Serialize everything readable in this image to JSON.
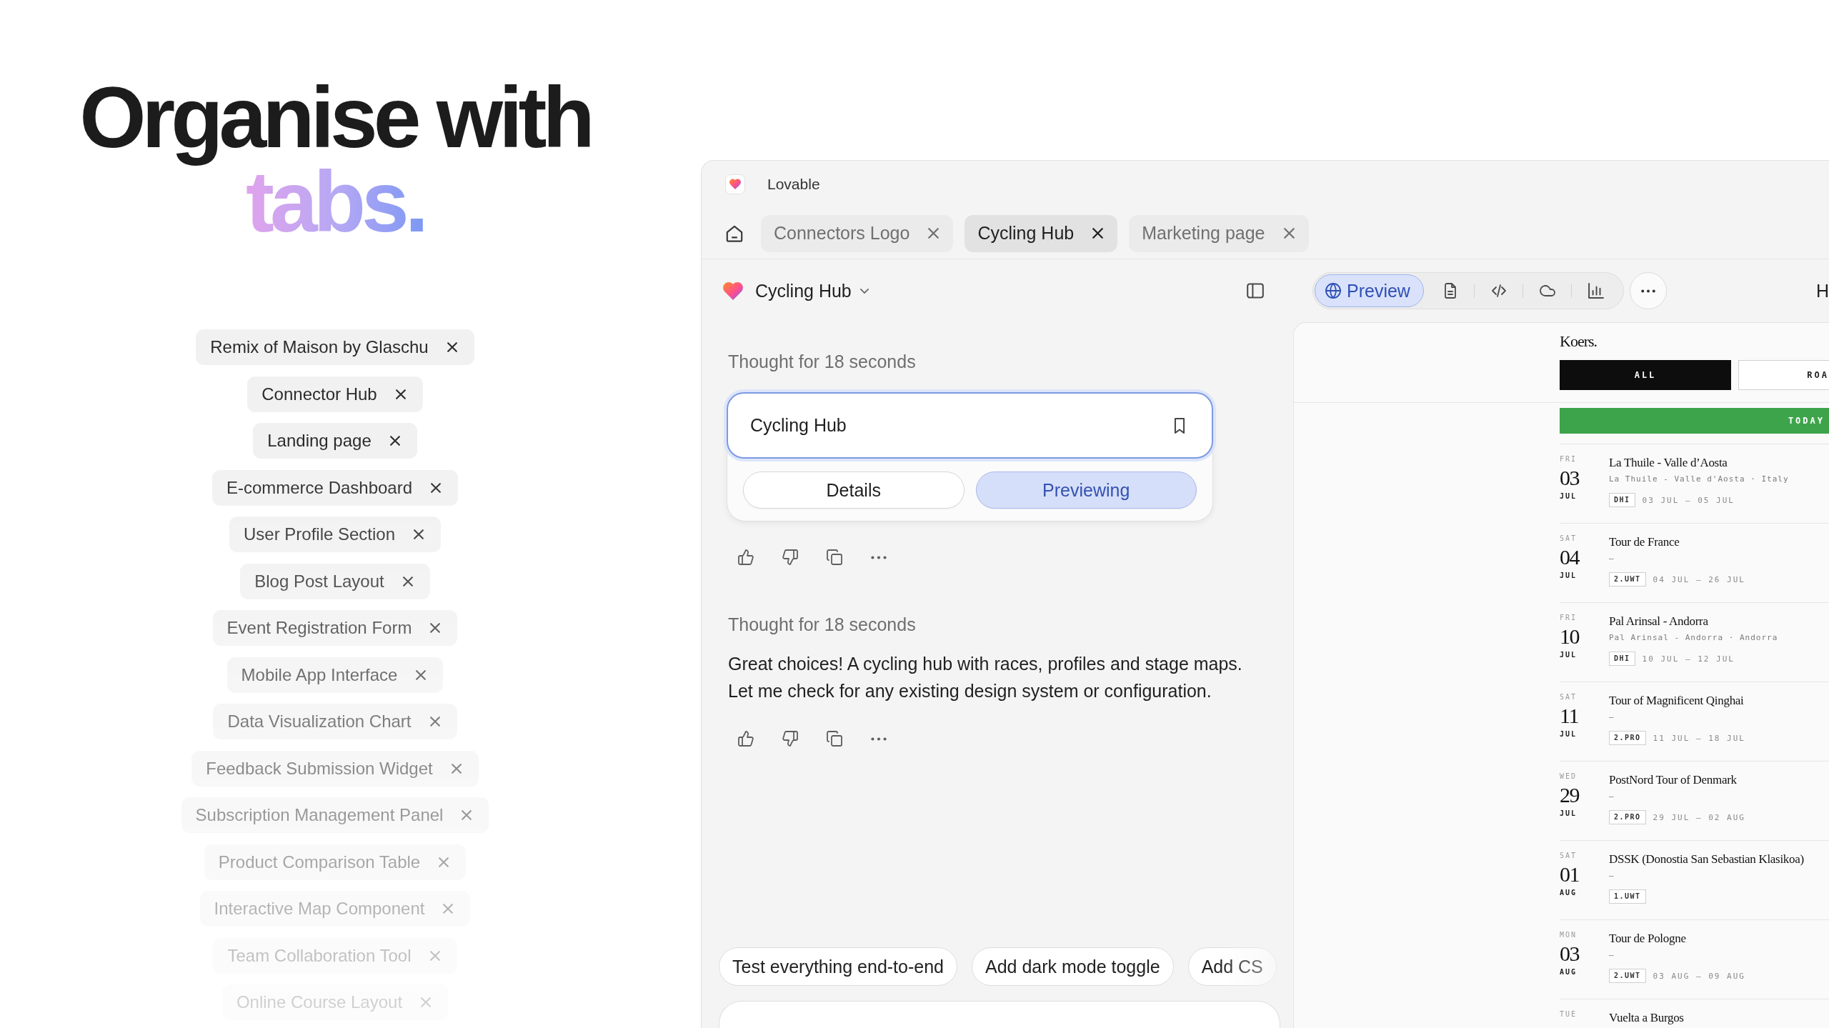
{
  "headline": {
    "line_1": "Organise with",
    "line_2": "tabs."
  },
  "tag_list": [
    "Remix of Maison by Glaschu",
    "Connector Hub",
    "Landing page",
    "E-commerce Dashboard",
    "User Profile Section",
    "Blog Post Layout",
    "Event Registration Form",
    "Mobile App Interface",
    "Data Visualization Chart",
    "Feedback Submission Widget",
    "Subscription Management Panel",
    "Product Comparison Table",
    "Interactive Map Component",
    "Team Collaboration Tool",
    "Online Course Layout"
  ],
  "window": {
    "title": "Lovable"
  },
  "tabs": [
    {
      "label": "Connectors Logo",
      "selected": false
    },
    {
      "label": "Cycling Hub",
      "selected": true
    },
    {
      "label": "Marketing page",
      "selected": false
    }
  ],
  "toolbar": {
    "project_name": "Cycling Hub",
    "view_buttons": [
      {
        "kind": "preview",
        "label": "Preview",
        "selected": true
      },
      {
        "kind": "file",
        "selected": false
      },
      {
        "kind": "code",
        "selected": false
      },
      {
        "kind": "cloud",
        "selected": false
      },
      {
        "kind": "analytics",
        "selected": false
      }
    ],
    "cut_label": "H"
  },
  "chat": {
    "messages": [
      {
        "kind": "card",
        "thought": "Thought for 18 seconds",
        "card_title": "Cycling Hub",
        "card_buttons": [
          {
            "label": "Details",
            "selected": false
          },
          {
            "label": "Previewing",
            "selected": true
          }
        ]
      },
      {
        "kind": "text",
        "thought": "Thought for 18 seconds",
        "text": "Great choices! A cycling hub with races, profiles and stage maps. Let me check for any existing design system or configuration."
      }
    ],
    "suggestions": [
      "Test everything end-to-end",
      "Add dark mode toggle",
      "Add CS"
    ]
  },
  "preview": {
    "brand": "Koers.",
    "filters": [
      {
        "label": "ALL",
        "selected": true
      },
      {
        "label": "ROA",
        "selected": false
      }
    ],
    "today_label": "TODAY",
    "events": [
      {
        "weekday": "FRI",
        "day": "03",
        "month": "JUL",
        "title": "La Thuile - Valle d’Aosta",
        "location": "La Thuile - Valle d'Aosta · Italy",
        "category": "DHI",
        "dates": "03 JUL – 05 JUL"
      },
      {
        "weekday": "SAT",
        "day": "04",
        "month": "JUL",
        "title": "Tour de France",
        "location": "–",
        "category": "2.UWT",
        "dates": "04 JUL – 26 JUL"
      },
      {
        "weekday": "FRI",
        "day": "10",
        "month": "JUL",
        "title": "Pal Arinsal - Andorra",
        "location": "Pal Arinsal - Andorra · Andorra",
        "category": "DHI",
        "dates": "10 JUL – 12 JUL"
      },
      {
        "weekday": "SAT",
        "day": "11",
        "month": "JUL",
        "title": "Tour of Magnificent Qinghai",
        "location": "–",
        "category": "2.PRO",
        "dates": "11 JUL – 18 JUL"
      },
      {
        "weekday": "WED",
        "day": "29",
        "month": "JUL",
        "title": "PostNord Tour of Denmark",
        "location": "–",
        "category": "2.PRO",
        "dates": "29 JUL – 02 AUG"
      },
      {
        "weekday": "SAT",
        "day": "01",
        "month": "AUG",
        "title": "DSSK (Donostia San Sebastian Klasikoa)",
        "location": "–",
        "category": "1.UWT"
      },
      {
        "weekday": "MON",
        "day": "03",
        "month": "AUG",
        "title": "Tour de Pologne",
        "location": "–",
        "category": "2.UWT",
        "dates": "03 AUG – 09 AUG"
      },
      {
        "weekday": "TUE",
        "title": "Vuelta a Burgos"
      }
    ]
  }
}
